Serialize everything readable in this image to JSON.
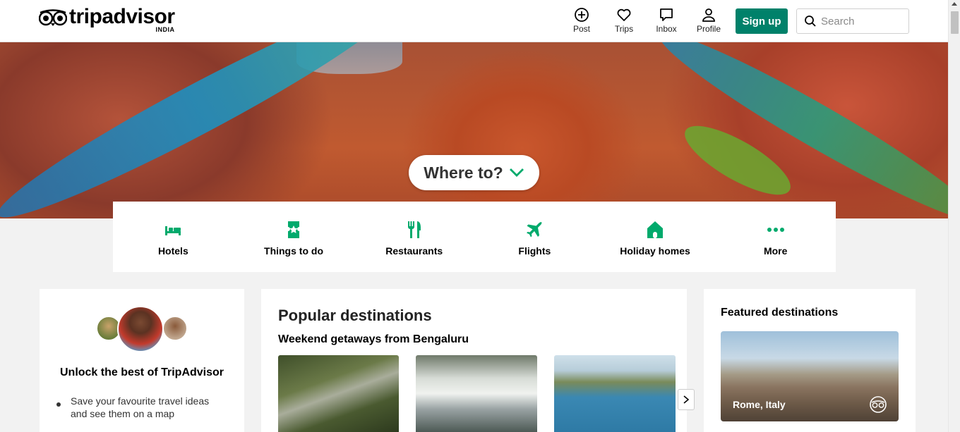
{
  "header": {
    "logo_text": "tripadvisor",
    "logo_region": "INDIA",
    "nav": [
      {
        "label": "Post",
        "icon": "plus-circle-icon"
      },
      {
        "label": "Trips",
        "icon": "heart-icon"
      },
      {
        "label": "Inbox",
        "icon": "chat-icon"
      },
      {
        "label": "Profile",
        "icon": "user-icon"
      }
    ],
    "signup_label": "Sign up",
    "search_placeholder": "Search"
  },
  "hero": {
    "where_label": "Where to?"
  },
  "categories": [
    {
      "label": "Hotels",
      "icon": "bed-icon"
    },
    {
      "label": "Things to do",
      "icon": "ticket-icon"
    },
    {
      "label": "Restaurants",
      "icon": "fork-knife-icon"
    },
    {
      "label": "Flights",
      "icon": "plane-icon"
    },
    {
      "label": "Holiday homes",
      "icon": "home-icon"
    },
    {
      "label": "More",
      "icon": "more-dots-icon"
    }
  ],
  "unlock_card": {
    "title": "Unlock the best of TripAdvisor",
    "bullet": "Save your favourite travel ideas and see them on a map"
  },
  "popular": {
    "title": "Popular destinations",
    "subtitle": "Weekend getaways from Bengaluru"
  },
  "featured": {
    "title": "Featured destinations",
    "item_label": "Rome, Italy"
  },
  "colors": {
    "brand_green": "#00816a",
    "icon_green": "#00aa6c"
  }
}
